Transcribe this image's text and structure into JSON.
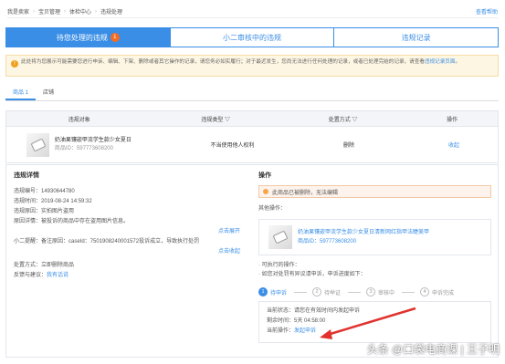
{
  "breadcrumb": {
    "items": [
      "我是卖家",
      "宝贝管理",
      "体检中心",
      "违规处理"
    ],
    "help": "查看帮助"
  },
  "tabs": [
    {
      "label": "待您处理的违规",
      "badge": "1"
    },
    {
      "label": "小二审核中的违规"
    },
    {
      "label": "违规记录"
    }
  ],
  "notice": {
    "line1": "此处将为您展示可能需要您进行申诉、编辑、下架、删除或者其它操作的记录，请您务必如实履行；对于最近发生，您尚无法进行任何处理的记录，或者已处理完结的记录，请查看",
    "link": "违规记录页面",
    "line2": "。"
  },
  "subtabs": [
    {
      "label": "商品 1"
    },
    {
      "label": "店铺"
    }
  ],
  "table": {
    "headers": [
      "违规对象",
      "违规类型 ▽",
      "处置方式 ▽",
      "操作"
    ],
    "row": {
      "title": "奶油果镶嵌甲流学生款少女夏日",
      "item_id": "商品ID：597773608200",
      "type": "不当使用他人权利",
      "action": "删除",
      "op": "收起"
    }
  },
  "detail": {
    "title": "违规详情",
    "fields": [
      "违规编号：14930644780",
      "违规时间：2019-08-24 14:59:32",
      "违规原因：实拍图片盗用",
      "原因详情：被投诉的商品中存在盗用图片信息。",
      "小二提醒：备注原因：caseId：7501908240001572投诉成立，导致执行处罚",
      "处置方式：立即删除商品",
      "反馈与建议："
    ],
    "expand1": "点击展开",
    "expand2": "点击收起",
    "feedback_link": "我有话说"
  },
  "operation": {
    "title": "操作",
    "warn": "此商品已被删除，无法编辑",
    "other_label": "其他操作：",
    "product_title": "奶油果镶嵌甲流学生款少女夏日清新网红指甲法睫美甲",
    "product_id": "商品ID：597773608200",
    "tips": [
      "可执行的操作：",
      "如您对处罚有异议请申诉，申诉进度如下："
    ],
    "steps": [
      {
        "num": "1",
        "label": "待申诉"
      },
      {
        "num": "2",
        "label": "待举证"
      },
      {
        "num": "3",
        "label": "审核中"
      },
      {
        "num": "4",
        "label": "申诉完成"
      }
    ],
    "status": {
      "state": "当前状态：请您在有效时间内发起申诉",
      "remain": "剩余时间：5天 04:58:00",
      "current": "当前操作：",
      "appeal_link": "发起申诉"
    }
  },
  "watermark": "头条 @口袋电商课 | 王子明",
  "colors": {
    "accent": "#3a8ee6",
    "badge": "#f36c22",
    "warn": "#f1a020",
    "arrow": "#e0332e"
  }
}
